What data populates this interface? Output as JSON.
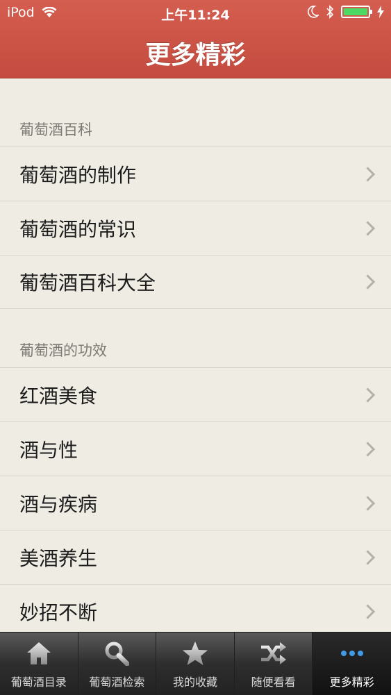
{
  "status": {
    "carrier": "iPod",
    "time": "上午11:24"
  },
  "nav": {
    "title": "更多精彩"
  },
  "sections": [
    {
      "header": "葡萄酒百科",
      "items": [
        "葡萄酒的制作",
        "葡萄酒的常识",
        "葡萄酒百科大全"
      ]
    },
    {
      "header": "葡萄酒的功效",
      "items": [
        "红酒美食",
        "酒与性",
        "酒与疾病",
        "美酒养生",
        "妙招不断"
      ]
    }
  ],
  "tabs": [
    {
      "label": "葡萄酒目录",
      "icon": "home-icon"
    },
    {
      "label": "葡萄酒检索",
      "icon": "search-icon"
    },
    {
      "label": "我的收藏",
      "icon": "star-icon"
    },
    {
      "label": "随便看看",
      "icon": "shuffle-icon"
    },
    {
      "label": "更多精彩",
      "icon": "more-icon"
    }
  ],
  "colors": {
    "nav_bg": "#c94e42",
    "background": "#efece4",
    "battery": "#4cd964"
  }
}
